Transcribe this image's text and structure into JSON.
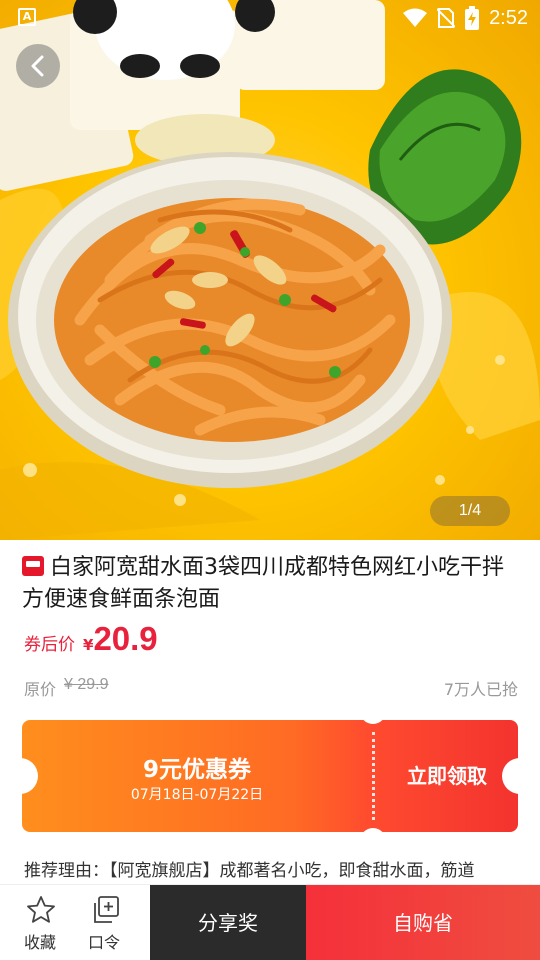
{
  "status_bar": {
    "time": "2:52",
    "app_indicator": "A",
    "icons": [
      "wifi-icon",
      "no-sim-icon",
      "battery-charging-icon"
    ]
  },
  "gallery": {
    "counter": "1/4",
    "image": "noodle-bowl-photo"
  },
  "product": {
    "title": "白家阿宽甜水面3袋四川成都特色网红小吃干拌方便速食鲜面条泡面",
    "badge_icon": "tmall-icon",
    "price_label": "券后价",
    "currency": "¥",
    "price": "20.9",
    "original_label": "原价",
    "original_price": "¥ 29.9",
    "sold": "7万人已抢"
  },
  "coupon": {
    "amount": "9元优惠券",
    "dates": "07月18日-07月22日",
    "claim": "立即领取"
  },
  "reason": {
    "label": "推荐理由：",
    "text": "【阿宽旗舰店】成都著名小吃，即食甜水面，筋道"
  },
  "bottom_bar": {
    "favorite": "收藏",
    "password": "口令",
    "share": "分享奖",
    "self_buy": "自购省"
  },
  "colors": {
    "accent": "#e8223c",
    "coupon_start": "#ff8e1d",
    "coupon_end": "#f3332f",
    "share_bg": "#2b2b2b",
    "buy_bg": "#f5303a"
  }
}
